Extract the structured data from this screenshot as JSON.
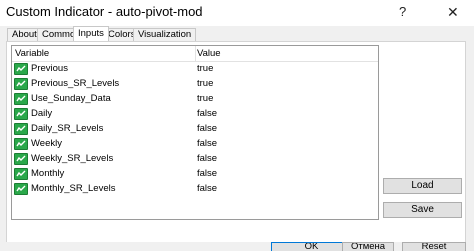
{
  "window": {
    "title": "Custom Indicator - auto-pivot-mod",
    "help_glyph": "?",
    "close_glyph": "✕"
  },
  "tabs": [
    {
      "label": "About"
    },
    {
      "label": "Common"
    },
    {
      "label": "Inputs"
    },
    {
      "label": "Colors"
    },
    {
      "label": "Visualization"
    }
  ],
  "active_tab": "Inputs",
  "grid": {
    "headers": {
      "variable": "Variable",
      "value": "Value"
    },
    "rows": [
      {
        "name": "Previous",
        "value": "true"
      },
      {
        "name": "Previous_SR_Levels",
        "value": "true"
      },
      {
        "name": "Use_Sunday_Data",
        "value": "true"
      },
      {
        "name": "Daily",
        "value": "false"
      },
      {
        "name": "Daily_SR_Levels",
        "value": "false"
      },
      {
        "name": "Weekly",
        "value": "false"
      },
      {
        "name": "Weekly_SR_Levels",
        "value": "false"
      },
      {
        "name": "Monthly",
        "value": "false"
      },
      {
        "name": "Monthly_SR_Levels",
        "value": "false"
      }
    ],
    "row_icon": "boolean-param-icon"
  },
  "buttons": {
    "load": "Load",
    "save": "Save",
    "ok": "OK",
    "cancel": "Отмена",
    "reset": "Reset"
  },
  "colors": {
    "icon_green": "#2aa84a",
    "ok_border": "#0078d7"
  }
}
